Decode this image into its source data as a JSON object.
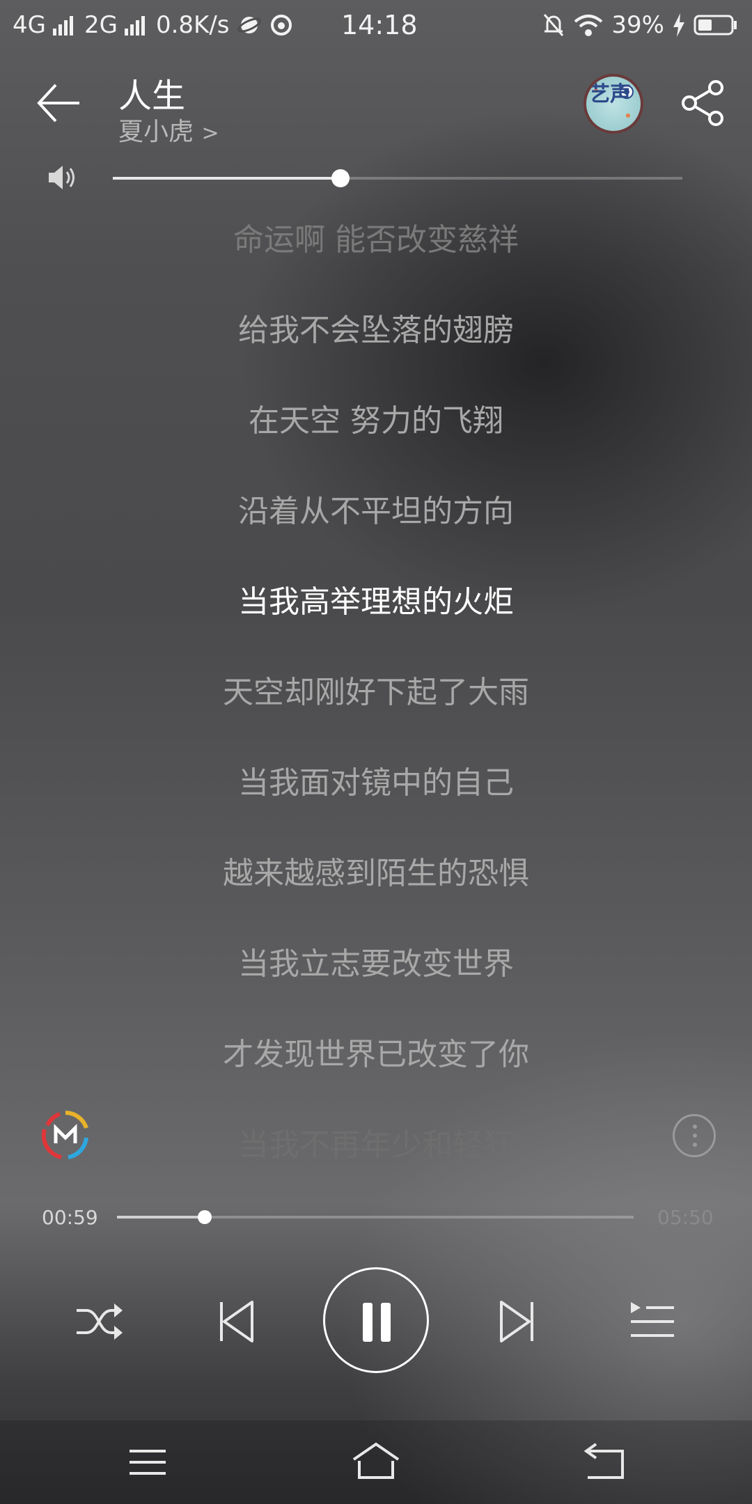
{
  "status_bar": {
    "network1": "4G",
    "network2": "2G",
    "speed": "0.8K/s",
    "time": "14:18",
    "battery": "39%"
  },
  "header": {
    "title": "人生",
    "artist": "夏小虎",
    "artist_chevron": ">",
    "logo_text": "艺声"
  },
  "volume": {
    "level": 0.4
  },
  "lyrics": [
    {
      "text": "命运啊 能否改变慈祥",
      "state": "faded-top"
    },
    {
      "text": "给我不会坠落的翅膀",
      "state": "normal"
    },
    {
      "text": "在天空 努力的飞翔",
      "state": "normal"
    },
    {
      "text": "沿着从不平坦的方向",
      "state": "normal"
    },
    {
      "text": "当我高举理想的火炬",
      "state": "active"
    },
    {
      "text": "天空却刚好下起了大雨",
      "state": "normal"
    },
    {
      "text": "当我面对镜中的自己",
      "state": "normal"
    },
    {
      "text": "越来越感到陌生的恐惧",
      "state": "normal"
    },
    {
      "text": "当我立志要改变世界",
      "state": "normal"
    },
    {
      "text": "才发现世界已改变了你",
      "state": "normal"
    },
    {
      "text": "当我不再年少和轻狂",
      "state": "faded-bottom"
    }
  ],
  "progress": {
    "current": "00:59",
    "total": "05:50",
    "fraction": 0.17
  },
  "controls": {
    "shuffle": "shuffle-icon",
    "previous": "previous-icon",
    "play_pause": "pause-icon",
    "next": "next-icon",
    "playlist": "playlist-icon"
  },
  "nav": {
    "menu": "menu-icon",
    "home": "home-icon",
    "back": "back-icon"
  }
}
